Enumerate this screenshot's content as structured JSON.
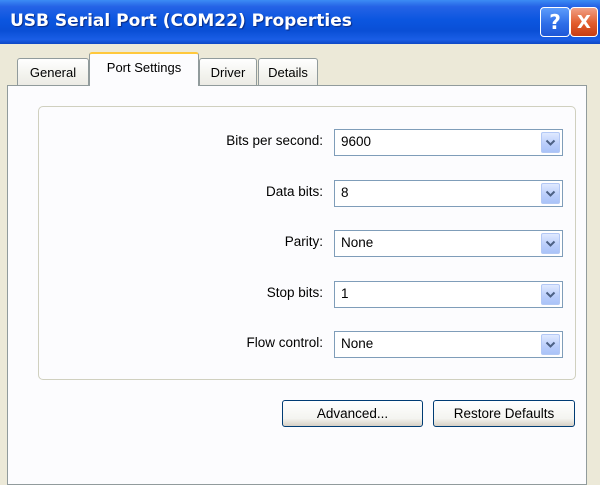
{
  "window": {
    "title": "USB Serial Port (COM22) Properties",
    "help_label": "?",
    "close_label": "X"
  },
  "tabs": [
    {
      "label": "General"
    },
    {
      "label": "Port Settings",
      "active": true
    },
    {
      "label": "Driver"
    },
    {
      "label": "Details"
    }
  ],
  "settings": {
    "bits_per_second": {
      "label": "Bits per second:",
      "value": "9600"
    },
    "data_bits": {
      "label": "Data bits:",
      "value": "8"
    },
    "parity": {
      "label": "Parity:",
      "value": "None"
    },
    "stop_bits": {
      "label": "Stop bits:",
      "value": "1"
    },
    "flow_control": {
      "label": "Flow control:",
      "value": "None"
    }
  },
  "buttons": {
    "advanced": "Advanced...",
    "restore_defaults": "Restore Defaults"
  },
  "icons": {
    "dropdown": "chevron-down-icon",
    "help": "help-icon",
    "close": "close-icon"
  },
  "colors": {
    "titlebar": "#0a4fd6",
    "active_tab_accent": "#ffc83c",
    "close_button": "#e25c2c"
  }
}
